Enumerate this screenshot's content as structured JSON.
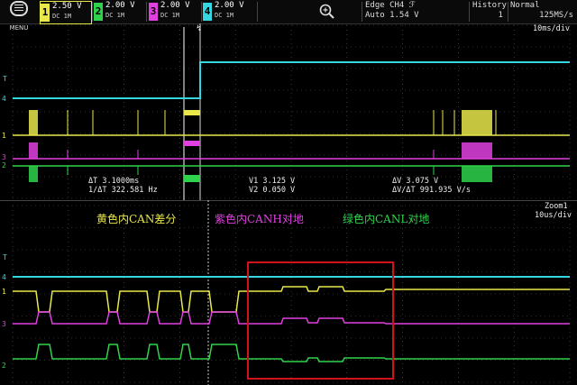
{
  "toolbar": {
    "menu_label": "MENU",
    "channels": [
      {
        "num": "1",
        "scale": "2.50 V",
        "coupling": "DC 1M",
        "color": "#e8e84a"
      },
      {
        "num": "2",
        "scale": "2.00 V",
        "coupling": "DC 1M",
        "color": "#2fd34b"
      },
      {
        "num": "3",
        "scale": "2.00 V",
        "coupling": "DC 1M",
        "color": "#e040e0"
      },
      {
        "num": "4",
        "scale": "2.00 V",
        "coupling": "DC 1M",
        "color": "#35d6e0"
      }
    ],
    "trigger_line1": "Edge CH4 ℱ",
    "trigger_line2": "Auto 1.54 V",
    "history_label": "History",
    "history_value": "1",
    "acq_mode": "Normal",
    "sample_rate": "125MS/s"
  },
  "main": {
    "timebase": "10ms/div",
    "cursor": {
      "dt": "ΔT  3.1000ms",
      "inv_dt": "1/ΔT  322.581 Hz",
      "v1": "V1  3.125 V",
      "v2": "V2  0.050 V",
      "dv": "ΔV  3.075 V",
      "dvdt": "ΔV/ΔT  991.935 V/s"
    }
  },
  "zoom": {
    "label": "Zoom1",
    "timebase": "10us/div"
  },
  "annotations": {
    "yellow_note": "黄色内CAN差分",
    "purple_note": "紫色内CANH对地",
    "green_note": "绿色内CANL对地"
  },
  "colors": {
    "ch1": "#e8e84a",
    "ch2": "#2fd34b",
    "ch3": "#e040e0",
    "ch4": "#35d6e0",
    "grid": "#5a5a5a",
    "highlight_box": "#d0131a"
  }
}
